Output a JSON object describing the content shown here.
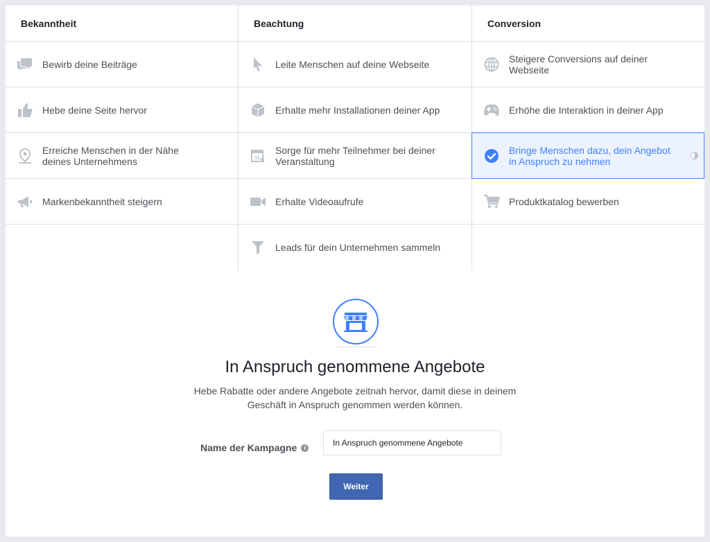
{
  "columns": [
    "Bekanntheit",
    "Beachtung",
    "Conversion"
  ],
  "objectives": {
    "bekanntheit": [
      {
        "icon": "speech-bubbles-icon",
        "label": "Bewirb deine Beiträge"
      },
      {
        "icon": "thumbs-up-icon",
        "label": "Hebe deine Seite hervor"
      },
      {
        "icon": "location-pin-icon",
        "label": "Erreiche Menschen in der Nähe deines Unternehmens"
      },
      {
        "icon": "megaphone-icon",
        "label": "Markenbekanntheit steigern"
      }
    ],
    "beachtung": [
      {
        "icon": "cursor-icon",
        "label": "Leite Menschen auf deine Webseite"
      },
      {
        "icon": "box-icon",
        "label": "Erhalte mehr Installationen deiner App"
      },
      {
        "icon": "calendar-icon",
        "label": "Sorge für mehr Teilnehmer bei deiner Veranstaltung"
      },
      {
        "icon": "video-camera-icon",
        "label": "Erhalte Videoaufrufe"
      },
      {
        "icon": "funnel-icon",
        "label": "Leads für dein Unternehmen sammeln"
      }
    ],
    "conversion": [
      {
        "icon": "globe-icon",
        "label": "Steigere Conversions auf deiner Webseite"
      },
      {
        "icon": "gamepad-icon",
        "label": "Erhöhe die Interaktion in deiner App"
      },
      {
        "icon": "check-circle-icon",
        "label": "Bringe Menschen dazu, dein Angebot in Anspruch zu nehmen",
        "selected": true
      },
      {
        "icon": "shopping-cart-icon",
        "label": "Produktkatalog bewerben"
      }
    ]
  },
  "detail": {
    "icon": "storefront-icon",
    "title": "In Anspruch genommene Angebote",
    "description": "Hebe Rabatte oder andere Angebote zeitnah hervor, damit diese in deinem Geschäft in Anspruch genommen werden können.",
    "campaign_label": "Name der Kampagne",
    "campaign_value": "In Anspruch genommene Angebote",
    "button_label": "Weiter"
  },
  "colors": {
    "accent": "#4080ff",
    "button": "#4267b2",
    "icon_gray": "#bec3c9"
  }
}
